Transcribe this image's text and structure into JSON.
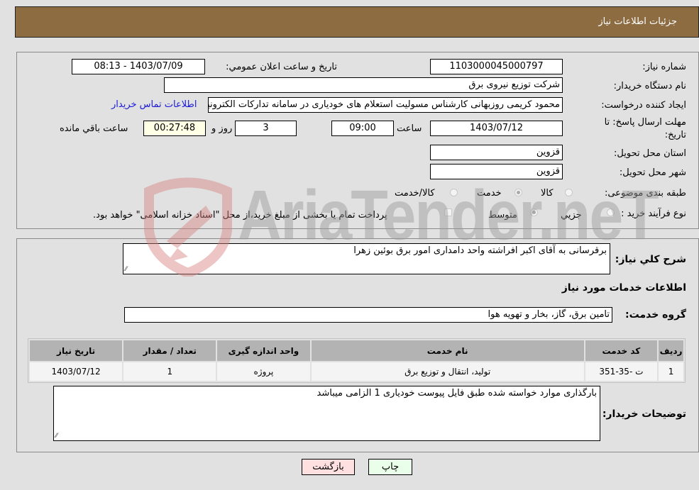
{
  "header": {
    "title": "جزئیات اطلاعات نیاز"
  },
  "form": {
    "need_number_label": "شماره نیاز:",
    "need_number": "1103000045000797",
    "announce_label": "تاریخ و ساعت اعلان عمومي:",
    "announce_value": "1403/07/09 - 08:13",
    "buyer_org_label": "نام دستگاه خریدار:",
    "buyer_org": "شرکت توزیع نیروی برق",
    "creator_label": "ایجاد کننده درخواست:",
    "creator": "محمود کریمی روزبهانی کارشناس  مسولیت استعلام های خودیاری در سامانه تدارکات الکترونیکی دولت",
    "contact_link": "اطلاعات تماس خریدار",
    "deadline_label_1": "مهلت ارسال پاسخ: تا",
    "deadline_label_2": "تاریخ:",
    "deadline_date": "1403/07/12",
    "time_label": "ساعت",
    "deadline_time": "09:00",
    "days": "3",
    "days_label": "روز و",
    "remaining_time": "00:27:48",
    "remaining_label": "ساعت باقي مانده",
    "province_label": "استان محل تحویل:",
    "province": "قزوین",
    "city_label": "شهر محل تحویل:",
    "city": "قزوین",
    "category_label": "طبقه بندی موضوعی:",
    "category_options": [
      {
        "label": "کالا",
        "selected": false
      },
      {
        "label": "خدمت",
        "selected": true
      },
      {
        "label": "کالا/خدمت",
        "selected": false
      }
    ],
    "process_label": "نوع فرآیند خرید :",
    "process_options": [
      {
        "label": "جزيي",
        "selected": false
      },
      {
        "label": "متوسط",
        "selected": true
      }
    ],
    "treasury_checkbox_label": "پرداخت تمام یا بخشی از مبلغ خرید،از محل \"اسناد خزانه اسلامی\" خواهد بود."
  },
  "details": {
    "description_label": "شرح کلي نیاز:",
    "description": "برقرسانی به آقای اکبر افراشته واحد دامداری امور برق بوئین زهرا",
    "services_heading": "اطلاعات خدمات مورد نیاز",
    "service_group_label": "گروه خدمت:",
    "service_group": "تامین برق، گاز، بخار و تهویه هوا",
    "table": {
      "headers": [
        "ردیف",
        "کد خدمت",
        "نام خدمت",
        "واحد اندازه گیری",
        "تعداد / مقدار",
        "تاریخ نیاز"
      ],
      "rows": [
        [
          "1",
          "ت -35-351",
          "تولید، انتقال و توزیع برق",
          "پروژه",
          "1",
          "1403/07/12"
        ]
      ]
    },
    "buyer_notes_label": "توضیحات خریدار:",
    "buyer_notes": "بارگذاری موارد خواسته شده طبق فایل پیوست خودیاری 1 الزامی میباشد"
  },
  "buttons": {
    "print": "چاپ",
    "back": "بازگشت"
  },
  "watermark": {
    "text": "AriaTender.neT"
  },
  "colors": {
    "header_bg": "#8d6c42",
    "link": "#1a1adb",
    "print_bg": "#eaffea",
    "back_bg": "#ffe0e0",
    "remaining_bg": "#ffffe5"
  }
}
